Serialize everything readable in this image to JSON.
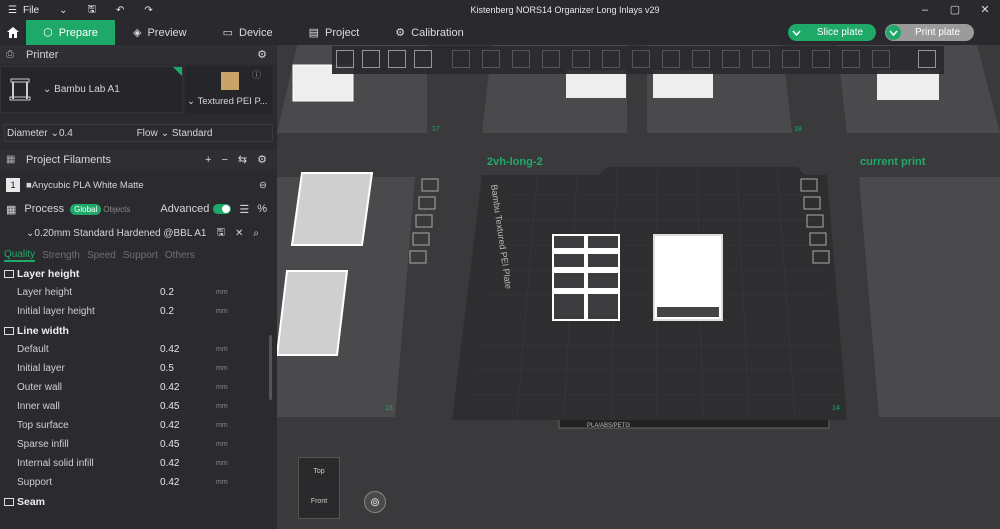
{
  "app": {
    "menu_label": "File",
    "window_title": "Kistenberg NORS14 Organizer Long Inlays v29"
  },
  "tabs": [
    {
      "label": "Prepare",
      "icon": "cube-icon"
    },
    {
      "label": "Preview",
      "icon": "layers-icon"
    },
    {
      "label": "Device",
      "icon": "device-icon"
    },
    {
      "label": "Project",
      "icon": "project-icon"
    },
    {
      "label": "Calibration",
      "icon": "calibration-icon"
    }
  ],
  "actions": {
    "slice": "Slice plate",
    "print": "Print plate"
  },
  "printer": {
    "section": "Printer",
    "name": "Bambu Lab A1",
    "plate": "Textured PEI P...",
    "diameter_label": "Diameter",
    "diameter": "0.4",
    "flow_label": "Flow",
    "flow": "Standard"
  },
  "filaments": {
    "section": "Project Filaments",
    "items": [
      {
        "index": "1",
        "name": "Anycubic PLA White Matte"
      }
    ]
  },
  "process": {
    "section": "Process",
    "global": "Global",
    "objects": "Objects",
    "advanced": "Advanced",
    "preset": "0.20mm Standard Hardened @BBL A1"
  },
  "subtabs": [
    "Quality",
    "Strength",
    "Speed",
    "Support",
    "Others"
  ],
  "groups": {
    "layer_height": {
      "title": "Layer height",
      "rows": [
        {
          "name": "Layer height",
          "value": "0.2",
          "unit": "mm"
        },
        {
          "name": "Initial layer height",
          "value": "0.2",
          "unit": "mm"
        }
      ]
    },
    "line_width": {
      "title": "Line width",
      "rows": [
        {
          "name": "Default",
          "value": "0.42",
          "unit": "mm"
        },
        {
          "name": "Initial layer",
          "value": "0.5",
          "unit": "mm"
        },
        {
          "name": "Outer wall",
          "value": "0.42",
          "unit": "mm"
        },
        {
          "name": "Inner wall",
          "value": "0.45",
          "unit": "mm"
        },
        {
          "name": "Top surface",
          "value": "0.42",
          "unit": "mm"
        },
        {
          "name": "Sparse infill",
          "value": "0.45",
          "unit": "mm"
        },
        {
          "name": "Internal solid infill",
          "value": "0.42",
          "unit": "mm"
        },
        {
          "name": "Support",
          "value": "0.42",
          "unit": "mm"
        }
      ]
    },
    "seam": {
      "title": "Seam"
    }
  },
  "viewport": {
    "plate_names": {
      "left": "2vh-long-2",
      "right": "current print"
    },
    "plate_numbers": {
      "a": "17",
      "b": "18",
      "c": "13",
      "d": "14"
    },
    "bed_label": "Bambu Textured PEI Plate",
    "bed_strip": "PLA/ABS/PETG",
    "cube": {
      "top": "Top",
      "front": "Front"
    }
  },
  "colors": {
    "accent": "#1fa968",
    "bg": "#2b2b2f",
    "viewport": "#3a3a3c"
  }
}
